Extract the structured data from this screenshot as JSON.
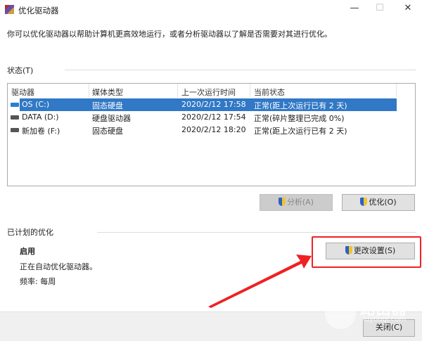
{
  "window": {
    "title": "优化驱动器",
    "minimize_icon": "—",
    "maximize_icon": "☐",
    "close_icon": "✕"
  },
  "description": "你可以优化驱动器以帮助计算机更高效地运行，或者分析驱动器以了解是否需要对其进行优化。",
  "status_label": "状态(T)",
  "table": {
    "headers": [
      "驱动器",
      "媒体类型",
      "上一次运行时间",
      "当前状态"
    ],
    "rows": [
      {
        "drive": "OS (C:)",
        "media": "固态硬盘",
        "last_run": "2020/2/12 17:58",
        "status": "正常(距上次运行已有 2 天)",
        "selected": true
      },
      {
        "drive": "DATA (D:)",
        "media": "硬盘驱动器",
        "last_run": "2020/2/12 17:54",
        "status": "正常(碎片整理已完成 0%)",
        "selected": false
      },
      {
        "drive": "新加卷 (F:)",
        "media": "固态硬盘",
        "last_run": "2020/2/12 18:20",
        "status": "正常(距上次运行已有 2 天)",
        "selected": false
      }
    ]
  },
  "buttons": {
    "analyze": "分析(A)",
    "optimize": "优化(O)",
    "change_settings": "更改设置(S)",
    "close": "关闭(C)"
  },
  "scheduled": {
    "label": "已计划的优化",
    "state": "启用",
    "detail": "正在自动优化驱动器。",
    "frequency": "频率: 每周"
  },
  "watermark": {
    "text": "路由器",
    "url": "luyouqi.com"
  },
  "colors": {
    "selection": "#3178c6",
    "annotation": "#ee2222"
  }
}
